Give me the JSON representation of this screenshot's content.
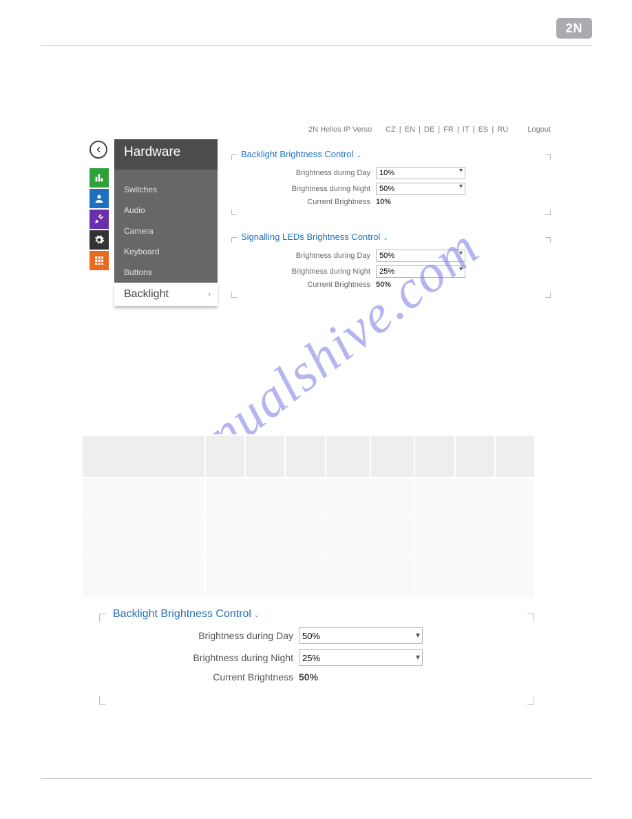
{
  "logo_text": "2N",
  "topbar": {
    "device": "2N Helios IP Verso",
    "langs": [
      "CZ",
      "EN",
      "DE",
      "FR",
      "IT",
      "ES",
      "RU"
    ],
    "logout": "Logout"
  },
  "sidebar": {
    "title": "Hardware",
    "items": [
      "Switches",
      "Audio",
      "Camera",
      "Keyboard",
      "Buttons"
    ],
    "active": "Backlight"
  },
  "panel1": {
    "title": "Backlight Brightness Control",
    "day_label": "Brightness during Day",
    "day_value": "10%",
    "night_label": "Brightness during Night",
    "night_value": "50%",
    "current_label": "Current Brightness",
    "current_value": "10%"
  },
  "panel2": {
    "title": "Signalling LEDs Brightness Control",
    "day_label": "Brightness during Day",
    "day_value": "50%",
    "night_label": "Brightness during Night",
    "night_value": "25%",
    "current_label": "Current Brightness",
    "current_value": "50%"
  },
  "watermark": "manualshive.com",
  "detail": {
    "title": "Backlight Brightness Control",
    "day_label": "Brightness during Day",
    "day_value": "50%",
    "night_label": "Brightness during Night",
    "night_value": "25%",
    "current_label": "Current Brightness",
    "current_value": "50%"
  }
}
